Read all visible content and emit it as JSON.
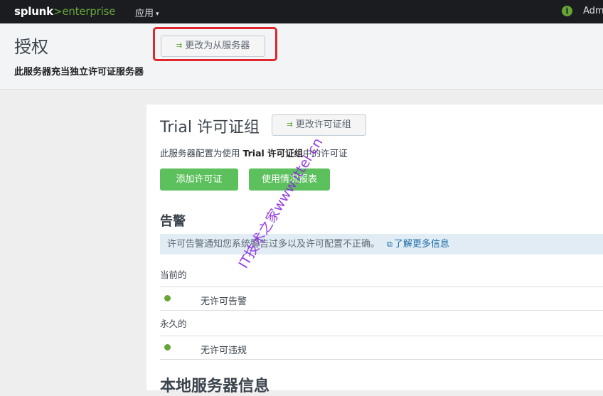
{
  "topbar": {
    "logo_splunk": "splunk",
    "logo_gt": ">",
    "logo_enterprise": "enterprise",
    "apps_menu_label": "应用",
    "caret": "▾",
    "info_icon": "i",
    "user_label": "Adm"
  },
  "header": {
    "title": "授权",
    "subtitle": "此服务器充当独立许可证服务器",
    "change_to_slave_label": "更改为从服务器",
    "swap_icon": "⇉"
  },
  "license_group": {
    "title": "Trial 许可证组",
    "change_group_label": "更改许可证组",
    "config_prefix": "此服务器配置为使用 ",
    "config_bold": "Trial 许可证组",
    "config_suffix": "中的许可证",
    "add_license_label": "添加许可证",
    "usage_report_label": "使用情况报表"
  },
  "alerts": {
    "title": "告警",
    "info_text": "许可告警通知您系统警告过多以及许可配置不正确。",
    "external_icon": "⧉",
    "learn_more": "了解更多信息",
    "current_label": "当前的",
    "current_item": "无许可告警",
    "permanent_label": "永久的",
    "permanent_item": "无许可违规"
  },
  "local_server": {
    "title": "本地服务器信息"
  },
  "watermark": "IT技术之家www.ittel.cn",
  "colors": {
    "accent_green": "#65a637",
    "primary_button": "#5cc05c",
    "highlight_red": "#e0262e",
    "info_bg": "#e1ecf4",
    "link_blue": "#1a6ca8",
    "watermark_purple": "#8a2be2"
  }
}
